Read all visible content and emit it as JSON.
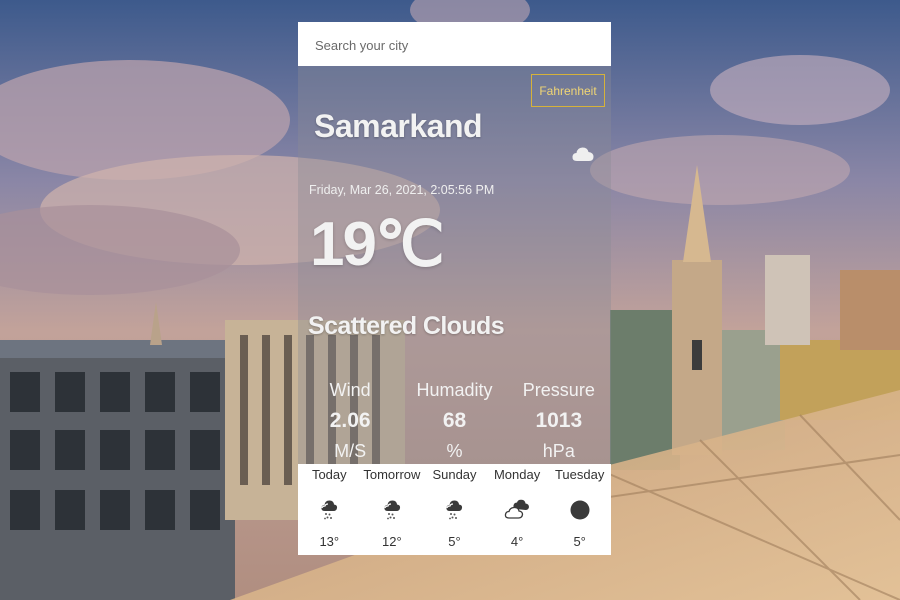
{
  "search": {
    "placeholder": "Search your city",
    "value": ""
  },
  "unit_toggle": {
    "label": "Fahrenheit"
  },
  "current": {
    "city": "Samarkand",
    "datetime": "Friday, Mar 26, 2021, 2:05:56 PM",
    "temperature": "19℃",
    "description": "Scattered Clouds",
    "icon": "cloud-icon"
  },
  "stats": [
    {
      "label": "Wind",
      "value": "2.06",
      "unit": "M/S"
    },
    {
      "label": "Humadity",
      "value": "68",
      "unit": "%"
    },
    {
      "label": "Pressure",
      "value": "1013",
      "unit": "hPa"
    }
  ],
  "forecast": [
    {
      "day": "Today",
      "temp": "13°",
      "icon": "cloud-rain-icon"
    },
    {
      "day": "Tomorrow",
      "temp": "12°",
      "icon": "cloud-rain-icon"
    },
    {
      "day": "Sunday",
      "temp": "5°",
      "icon": "cloud-rain-icon"
    },
    {
      "day": "Monday",
      "temp": "4°",
      "icon": "partly-cloudy-icon"
    },
    {
      "day": "Tuesday",
      "temp": "5°",
      "icon": "moon-icon"
    }
  ],
  "colors": {
    "accent": "#d6b23a",
    "accent_text": "#f1d674",
    "icon_dark": "#3a3a3a"
  }
}
